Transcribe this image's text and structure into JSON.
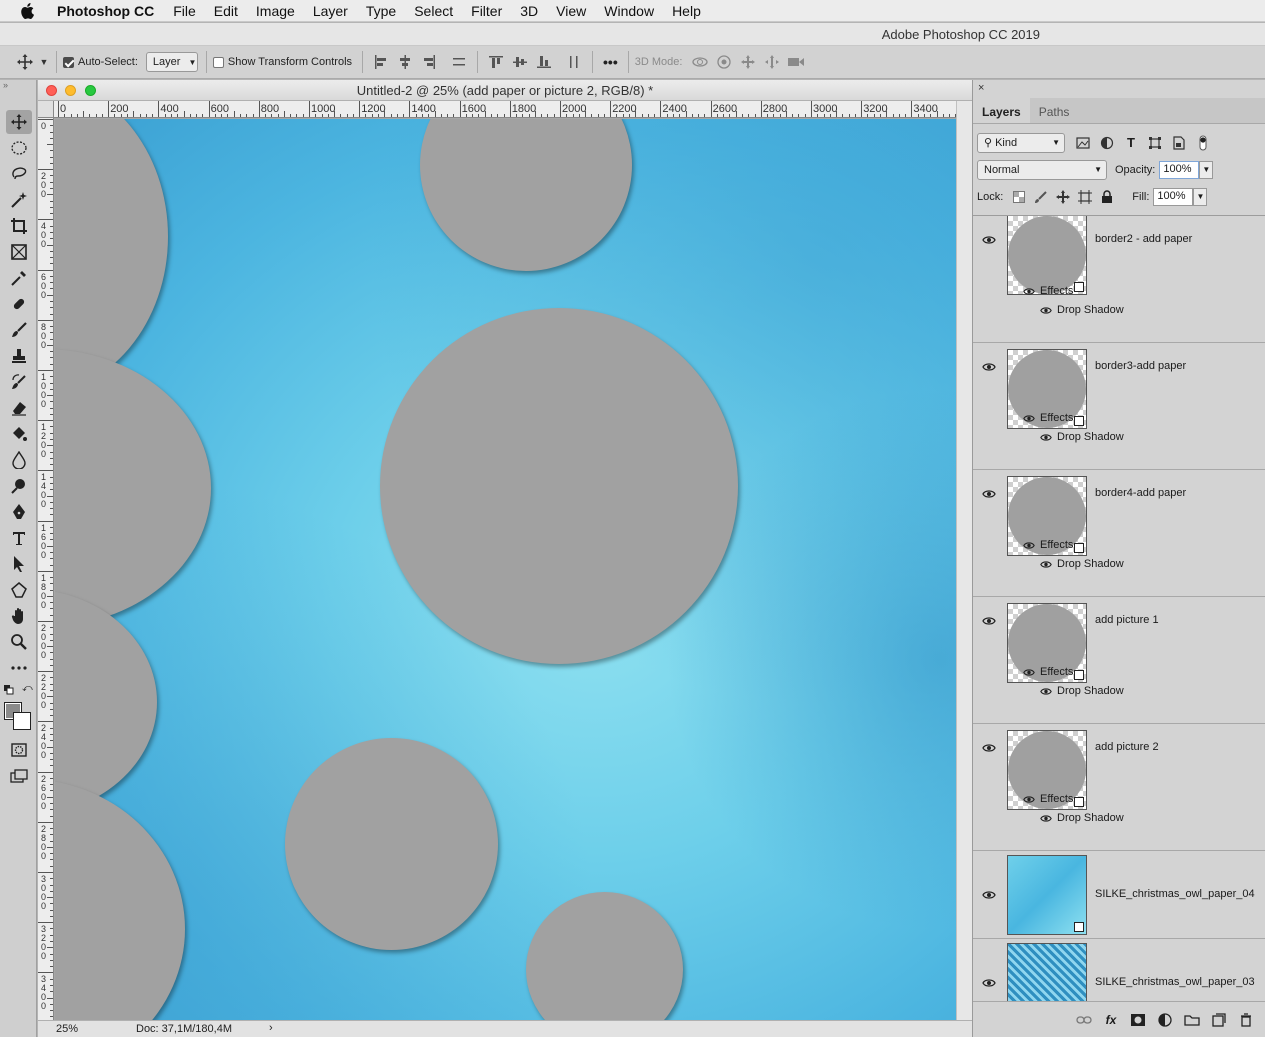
{
  "menubar": {
    "app_name": "Photoshop CC",
    "items": [
      "File",
      "Edit",
      "Image",
      "Layer",
      "Type",
      "Select",
      "Filter",
      "3D",
      "View",
      "Window",
      "Help"
    ]
  },
  "app_title": "Adobe Photoshop CC 2019",
  "options_bar": {
    "auto_select_label": "Auto-Select:",
    "auto_select_checked": true,
    "auto_select_value": "Layer",
    "show_transform_label": "Show Transform Controls",
    "show_transform_checked": false,
    "more_label": "•••",
    "mode_3d_label": "3D Mode:"
  },
  "document": {
    "title": "Untitled-2 @ 25% (add paper or picture 2, RGB/8) *",
    "ruler_h_labels": [
      "0",
      "200",
      "400",
      "600",
      "800",
      "1000",
      "1200",
      "1400",
      "1600",
      "1800",
      "2000",
      "2200",
      "2400",
      "2600",
      "2800",
      "3000",
      "3200",
      "3400"
    ],
    "ruler_v_labels": [
      "0",
      "200",
      "400",
      "600",
      "800",
      "1000",
      "1200",
      "1400",
      "1600",
      "1800",
      "2000",
      "2200",
      "2400",
      "2600",
      "2800",
      "3000",
      "3200",
      "3400"
    ],
    "zoom": "25%",
    "doc_size": "Doc: 37,1M/180,4M",
    "status_arrow": "›"
  },
  "layers_panel": {
    "close": "×",
    "tabs": [
      "Layers",
      "Paths"
    ],
    "filter_kind": "Kind",
    "blend_mode": "Normal",
    "opacity_label": "Opacity:",
    "opacity_value": "100%",
    "lock_label": "Lock:",
    "fill_label": "Fill:",
    "fill_value": "100%",
    "effects_label": "Effects",
    "drop_shadow_label": "Drop Shadow",
    "layers": [
      {
        "name": "border2 - add paper",
        "has_effects": true
      },
      {
        "name": "border3-add paper",
        "has_effects": true
      },
      {
        "name": "border4-add paper",
        "has_effects": true
      },
      {
        "name": "add picture  1",
        "has_effects": true
      },
      {
        "name": "add picture 2",
        "has_effects": true
      },
      {
        "name": "SILKE_christmas_owl_paper_04",
        "has_effects": false
      },
      {
        "name": "SILKE_christmas_owl_paper_03",
        "has_effects": false
      }
    ],
    "bottom_fx_label": "fx"
  },
  "colors": {
    "canvas_blue": "#5ec3e6",
    "placeholder_gray": "#a1a1a1",
    "panel_bg": "#d3d3d3"
  },
  "icons": {
    "tools": [
      "move-icon",
      "ellipse-marquee-icon",
      "lasso-icon",
      "magic-wand-icon",
      "crop-icon",
      "frame-icon",
      "eyedropper-icon",
      "healing-icon",
      "brush-icon",
      "stamp-icon",
      "history-brush-icon",
      "eraser-icon",
      "paint-bucket-icon",
      "blur-icon",
      "dodge-icon",
      "pen-icon",
      "type-icon",
      "path-select-icon",
      "shape-icon",
      "hand-icon",
      "zoom-icon",
      "more-tools-icon"
    ]
  }
}
